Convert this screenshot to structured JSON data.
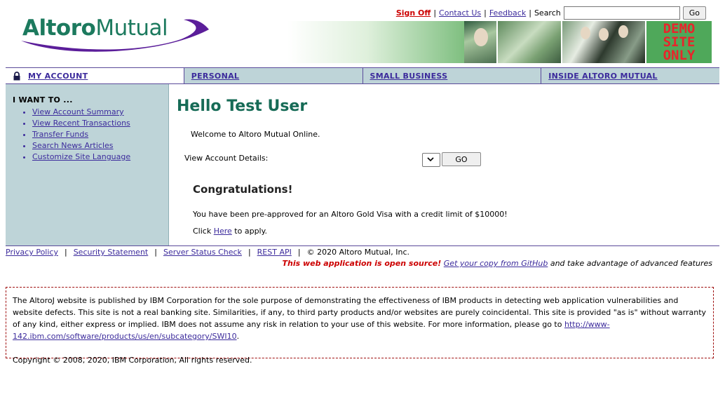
{
  "header": {
    "logo": {
      "bold": "Altoro",
      "light": "Mutual"
    },
    "links": {
      "sign_off": "Sign Off",
      "contact_us": "Contact Us",
      "feedback": "Feedback",
      "search_label": "Search"
    },
    "search": {
      "value": "",
      "placeholder": ""
    },
    "go_label": "Go",
    "banner": {
      "demo_lines": [
        "DEMO",
        "SITE",
        "ONLY"
      ]
    }
  },
  "nav": {
    "tabs": [
      {
        "label": "MY ACCOUNT",
        "active": true
      },
      {
        "label": "PERSONAL",
        "active": false
      },
      {
        "label": "SMALL BUSINESS",
        "active": false
      },
      {
        "label": "INSIDE ALTORO MUTUAL",
        "active": false
      }
    ]
  },
  "sidebar": {
    "heading": "I WANT TO ...",
    "items": [
      {
        "label": "View Account Summary"
      },
      {
        "label": "View Recent Transactions"
      },
      {
        "label": "Transfer Funds"
      },
      {
        "label": "Search News Articles"
      },
      {
        "label": "Customize Site Language"
      }
    ]
  },
  "main": {
    "title": "Hello Test User",
    "welcome": "Welcome to Altoro Mutual Online.",
    "details_label": "View Account Details:",
    "go_label": "GO",
    "congrats": "Congratulations!",
    "preapproved": "You have been pre-approved for an Altoro Gold Visa with a credit limit of $10000!",
    "click_prefix": "Click ",
    "here_link": "Here",
    "click_suffix": " to apply."
  },
  "footer": {
    "links": {
      "privacy": "Privacy Policy",
      "security": "Security Statement",
      "server_status": "Server Status Check",
      "rest_api": "REST API",
      "sep": "|"
    },
    "copyright_short": "© 2020 Altoro Mutual, Inc.",
    "open_source_red": "This web application is open source!",
    "github_link": "Get your copy from GitHub",
    "open_source_suffix": " and take advantage of advanced features",
    "disclaimer_text": "The AltoroJ website is published by IBM Corporation for the sole purpose of demonstrating the effectiveness of IBM products in detecting web application vulnerabilities and website defects. This site is not a real banking site. Similarities, if any, to third party products and/or websites are purely coincidental. This site is provided \"as is\" without warranty of any kind, either express or implied. IBM does not assume any risk in relation to your use of this website. For more information, please go to ",
    "disclaimer_link": "http://www-142.ibm.com/software/products/us/en/subcategory/SWI10",
    "disclaimer_end": ".",
    "copyright_full": "Copyright © 2008, 2020, IBM Corporation, All rights reserved."
  },
  "colors": {
    "brand_green": "#166b56",
    "nav_bg": "#bed4d8",
    "link": "#3c2b9c",
    "alert_red": "#cc0000"
  }
}
